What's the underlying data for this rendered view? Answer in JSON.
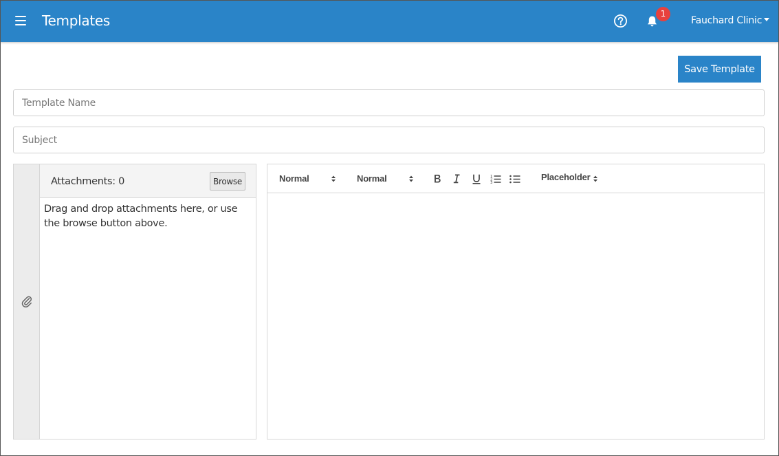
{
  "header": {
    "title": "Templates",
    "notification_count": "1",
    "user_menu_label": "Fauchard Clinic",
    "icons": {
      "menu": "hamburger-menu-icon",
      "help": "question-circle-icon",
      "notifications": "bell-icon",
      "user_menu": "caret-down-icon"
    }
  },
  "actions": {
    "save_label": "Save Template"
  },
  "form": {
    "template_name": {
      "value": "",
      "placeholder": "Template Name"
    },
    "subject": {
      "value": "",
      "placeholder": "Subject"
    }
  },
  "attachments": {
    "count_label": "Attachments: 0",
    "browse_label": "Browse",
    "drop_hint": "Drag and drop attachments here, or use the browse button above.",
    "icon": "paperclip-icon"
  },
  "editor": {
    "toolbar": {
      "size_select": "Normal",
      "font_select": "Normal",
      "placeholder_select": "Placeholder",
      "buttons": [
        "bold-icon",
        "italic-icon",
        "underline-icon",
        "ordered-list-icon",
        "bullet-list-icon"
      ]
    },
    "content": ""
  },
  "colors": {
    "brand": "#2a84c8",
    "badge": "#e8413d",
    "panel_strip": "#ececec"
  }
}
